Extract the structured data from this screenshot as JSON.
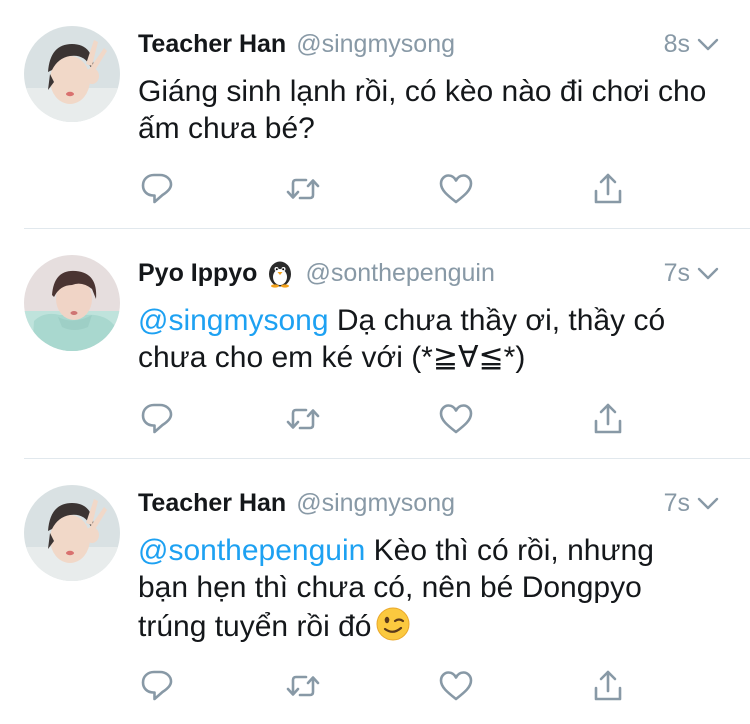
{
  "tweets": [
    {
      "name": "Teacher Han",
      "handle": "@singmysong",
      "time": "8s",
      "text": "Giáng sinh lạnh rồi, có kèo nào đi chơi cho ấm chưa bé?"
    },
    {
      "name": "Pyo Ippyo",
      "name_emoji": "penguin-icon",
      "handle": "@sonthepenguin",
      "time": "7s",
      "mention": "@singmysong",
      "text": " Dạ chưa thầy ơi, thầy có chưa cho em ké với (*≧∀≦*)"
    },
    {
      "name": "Teacher Han",
      "handle": "@singmysong",
      "time": "7s",
      "mention": "@sonthepenguin",
      "text": " Kèo thì có rồi, nhưng bạn hẹn thì chưa có, nên bé Dongpyo trúng tuyển rồi đó",
      "trailing_emoji": "winking-face-icon"
    }
  ],
  "icons": {
    "reply": "reply-icon",
    "retweet": "retweet-icon",
    "like": "heart-icon",
    "share": "share-icon",
    "menu": "chevron-down-icon"
  },
  "colors": {
    "text": "#14171a",
    "secondary": "#8899a6",
    "mention": "#1da1f2",
    "divider": "#e1e8ed"
  }
}
